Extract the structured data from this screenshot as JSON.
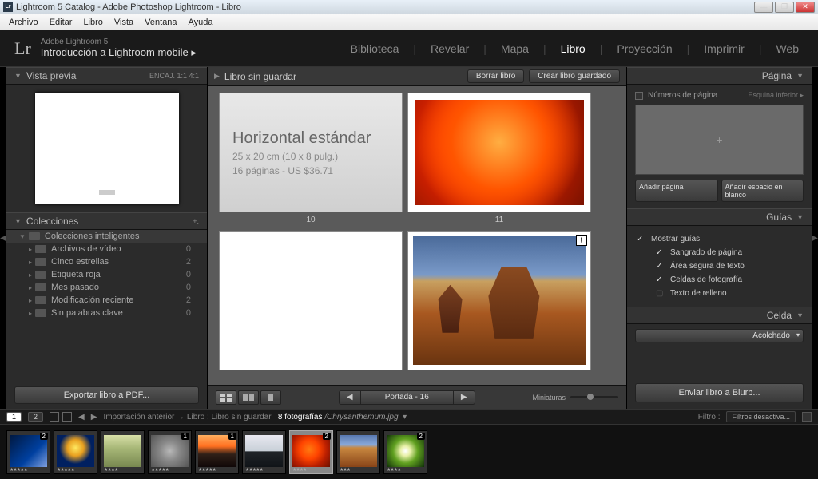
{
  "window": {
    "title": "Lightroom 5 Catalog - Adobe Photoshop Lightroom - Libro",
    "app_icon_text": "Lr"
  },
  "menu": [
    "Archivo",
    "Editar",
    "Libro",
    "Vista",
    "Ventana",
    "Ayuda"
  ],
  "topbar": {
    "logo": "Lr",
    "product": "Adobe Lightroom 5",
    "breadcrumb": "Introducción a Lightroom mobile  ▸",
    "modules": [
      "Biblioteca",
      "Revelar",
      "Mapa",
      "Libro",
      "Proyección",
      "Imprimir",
      "Web"
    ],
    "active_module": "Libro"
  },
  "left": {
    "preview_title": "Vista previa",
    "preview_right": "ENCAJ.   1:1   4:1",
    "collections_title": "Colecciones",
    "smart_header": "Colecciones inteligentes",
    "items": [
      {
        "name": "Archivos de vídeo",
        "count": "0"
      },
      {
        "name": "Cinco estrellas",
        "count": "2"
      },
      {
        "name": "Etiqueta roja",
        "count": "0"
      },
      {
        "name": "Mes pasado",
        "count": "0"
      },
      {
        "name": "Modificación reciente",
        "count": "2"
      },
      {
        "name": "Sin palabras clave",
        "count": "0"
      }
    ],
    "export_btn": "Exportar libro a PDF..."
  },
  "center": {
    "title": "Libro sin guardar",
    "clear_btn": "Borrar libro",
    "save_btn": "Crear libro guardado",
    "page10": {
      "title": "Horizontal estándar",
      "line2": "25 x 20 cm (10 x 8 pulg.)",
      "line3": "16 páginas - US $36.71"
    },
    "label10": "10",
    "label11": "11",
    "warn": "!",
    "pager": "Portada - 16",
    "thumb_label": "Miniaturas"
  },
  "right": {
    "page_title": "Página",
    "page_numbers_label": "Números de página",
    "page_numbers_val": "Esquina inferior ▸",
    "add_page_btn": "Añadir página",
    "add_blank_btn": "Añadir espacio en blanco",
    "guides_title": "Guías",
    "show_guides": "Mostrar guías",
    "guide_items": [
      {
        "label": "Sangrado de página",
        "checked": true
      },
      {
        "label": "Área segura de texto",
        "checked": true
      },
      {
        "label": "Celdas de fotografía",
        "checked": true
      },
      {
        "label": "Texto de relleno",
        "checked": false
      }
    ],
    "cell_title": "Celda",
    "padding_btn": "Acolchado",
    "blurb_btn": "Enviar libro a Blurb..."
  },
  "secondbar": {
    "page1": "1",
    "page2": "2",
    "path_prefix": "Importación anterior  →  Libro : Libro sin guardar",
    "count": "8 fotografías",
    "filename": "/Chrysanthemum.jpg",
    "filter_label": "Filtro :",
    "filter_value": "Filtros desactiva..."
  },
  "filmstrip": [
    {
      "badge": "2",
      "stars": "★★★★★"
    },
    {
      "badge": "",
      "stars": "★★★★★"
    },
    {
      "badge": "",
      "stars": "★★★★"
    },
    {
      "badge": "1",
      "stars": "★★★★★"
    },
    {
      "badge": "1",
      "stars": "★★★★★"
    },
    {
      "badge": "",
      "stars": "★★★★★"
    },
    {
      "badge": "2",
      "stars": "★★★★"
    },
    {
      "badge": "",
      "stars": "★★★"
    },
    {
      "badge": "2",
      "stars": "★★★★"
    }
  ]
}
